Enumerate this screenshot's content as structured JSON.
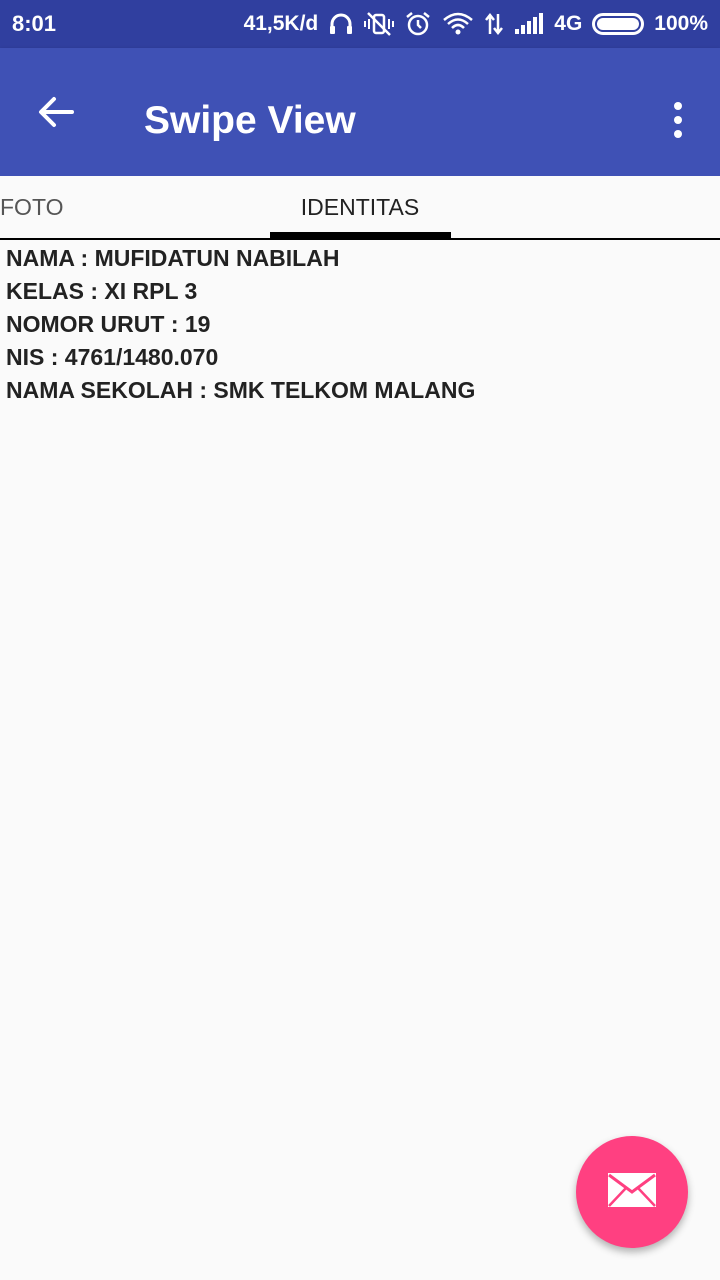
{
  "status_bar": {
    "time": "8:01",
    "speed": "41,5K/d",
    "network": "4G",
    "battery": "100%"
  },
  "toolbar": {
    "title": "Swipe View",
    "back_icon": "arrow-back-icon",
    "menu_icon": "more-vert-icon"
  },
  "tabs": [
    {
      "label": "FOTO",
      "selected": false
    },
    {
      "label": "IDENTITAS",
      "selected": true
    }
  ],
  "identity": {
    "lines": [
      "NAMA : MUFIDATUN NABILAH",
      "KELAS : XI RPL 3",
      "NOMOR URUT : 19",
      "NIS : 4761/1480.070",
      "NAMA SEKOLAH : SMK TELKOM MALANG"
    ]
  },
  "fab": {
    "icon": "mail-icon"
  },
  "colors": {
    "status_bar": "#303F9F",
    "primary": "#3F51B5",
    "accent": "#FF4081",
    "background": "#fafafa"
  }
}
